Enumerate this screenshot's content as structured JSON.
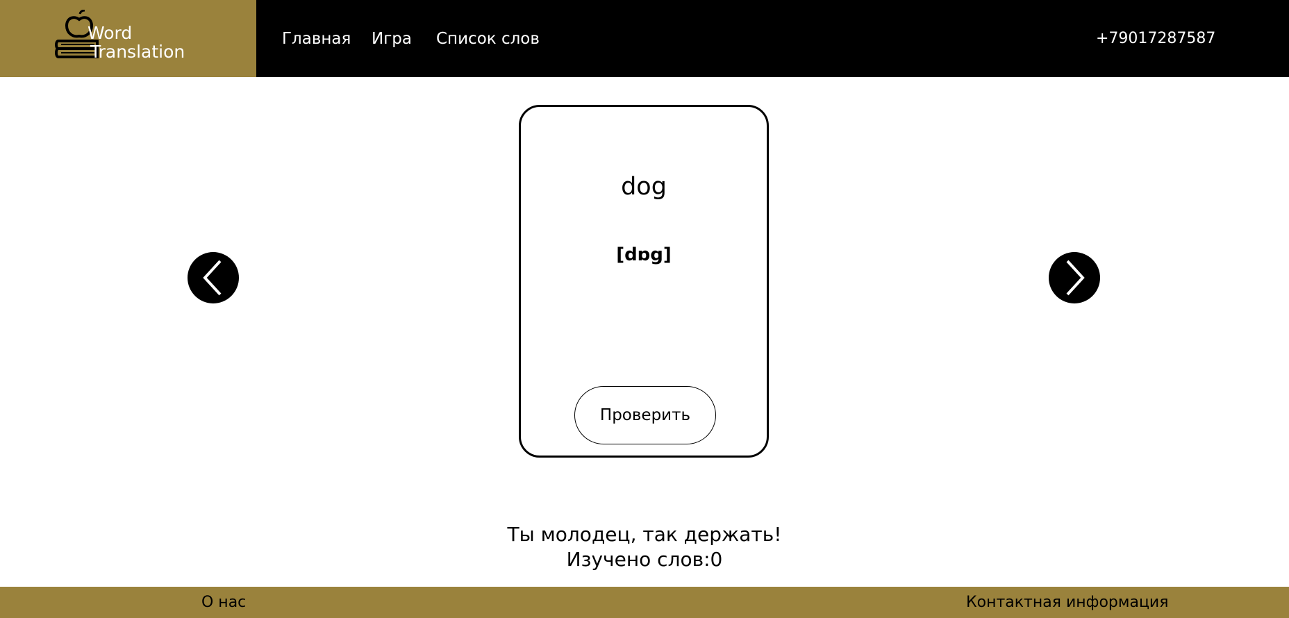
{
  "header": {
    "logo": {
      "line1": "Word",
      "line2": "Translation",
      "icon": "apple-on-books-icon"
    },
    "nav": {
      "home": "Главная",
      "game": "Игра",
      "word_list": "Список слов"
    },
    "phone": "+79017287587"
  },
  "card": {
    "word": "dog",
    "transcription": "[dɒg]",
    "check_label": "Проверить"
  },
  "navigation": {
    "prev_icon": "chevron-left-icon",
    "next_icon": "chevron-right-icon"
  },
  "status": {
    "motivation": "Ты молодец, так держать!",
    "learned": "Изучено слов:0"
  },
  "footer": {
    "about": "О нас",
    "contacts": "Контактная информация"
  },
  "colors": {
    "accent": "#9a823c",
    "header_bg": "#000000",
    "page_bg": "#ffffff"
  }
}
